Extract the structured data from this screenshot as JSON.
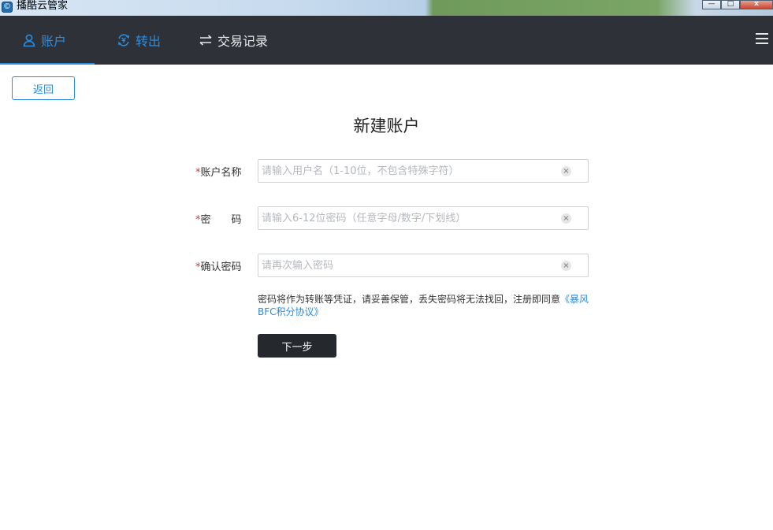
{
  "window": {
    "title": "播酷云管家",
    "icon": "app-logo-icon",
    "controls": {
      "minimize": "—",
      "maximize": "□",
      "close": "x"
    }
  },
  "nav": {
    "tabs": [
      {
        "label": "账户",
        "icon": "user-icon",
        "active": true
      },
      {
        "label": "转出",
        "icon": "transfer-out-icon",
        "active": false
      },
      {
        "label": "交易记录",
        "icon": "swap-arrows-icon",
        "active": false
      }
    ],
    "menu_icon": "hamburger-menu-icon"
  },
  "back_label": "返回",
  "page_title": "新建账户",
  "form": {
    "required_mark": "*",
    "username": {
      "label": "账户名称",
      "placeholder": "请输入用户名（1-10位，不包含特殊字符）",
      "value": ""
    },
    "password": {
      "label": "密　　码",
      "placeholder": "请输入6-12位密码（任意字母/数字/下划线）",
      "value": ""
    },
    "confirm": {
      "label": "确认密码",
      "placeholder": "请再次输入密码",
      "value": ""
    },
    "clear_glyph": "×"
  },
  "notice": {
    "text": "密码将作为转账等凭证，请妥善保管，丢失密码将无法找回，注册即同意",
    "link": "《暴风BFC积分协议》"
  },
  "next_label": "下一步",
  "colors": {
    "accent": "#2a8de0",
    "nav_bg": "#2e3138",
    "required": "#e0352b",
    "button_dark": "#25282d"
  }
}
